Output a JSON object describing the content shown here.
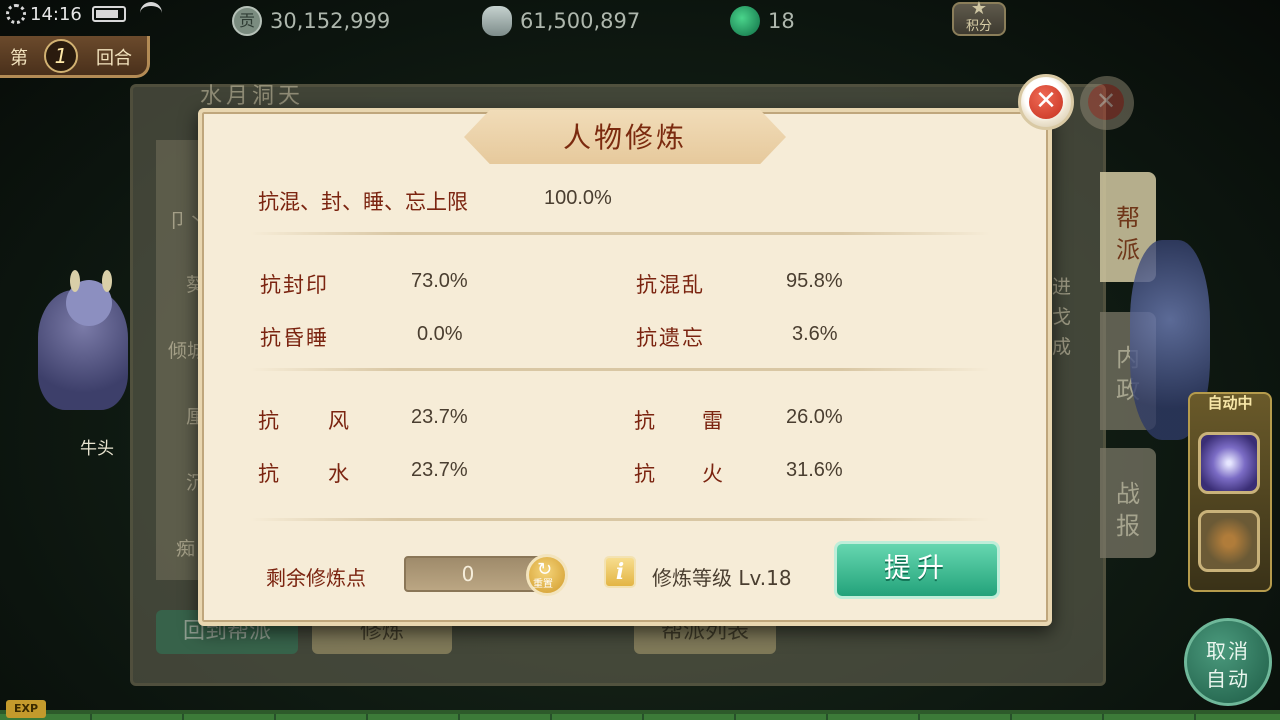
{
  "status_bar": {
    "time": "14:16"
  },
  "resources": {
    "contribution": "30,152,999",
    "silver": "61,500,897",
    "jade": "18",
    "score_label": "积分"
  },
  "round": {
    "prefix": "第",
    "number": "1",
    "suffix": "回合"
  },
  "background": {
    "panel_title": "水月洞天",
    "row_labels": [
      "卩丶",
      "葵",
      "倾城",
      "厘",
      "沉",
      "痴"
    ],
    "buttons": [
      "回到帮派",
      "修炼",
      "帮派列表"
    ],
    "side_tabs": [
      "帮派",
      "内政",
      "战报"
    ],
    "side_text": [
      "进",
      "戈",
      "成"
    ]
  },
  "npc": {
    "name": "牛头"
  },
  "auto_panel": {
    "label": "自动中"
  },
  "cancel_auto": {
    "line1": "取消",
    "line2": "自动"
  },
  "exp_badge": "EXP",
  "modal": {
    "title": "人物修炼",
    "upper_limit": {
      "label": "抗混、封、睡、忘上限",
      "value": "100.0%"
    },
    "stats_group1": [
      {
        "label": "抗封印",
        "value": "73.0%"
      },
      {
        "label": "抗混乱",
        "value": "95.8%"
      },
      {
        "label": "抗昏睡",
        "value": "0.0%"
      },
      {
        "label": "抗遗忘",
        "value": "3.6%"
      }
    ],
    "stats_group2": [
      {
        "label_a": "抗",
        "label_b": "风",
        "value": "23.7%"
      },
      {
        "label_a": "抗",
        "label_b": "雷",
        "value": "26.0%"
      },
      {
        "label_a": "抗",
        "label_b": "水",
        "value": "23.7%"
      },
      {
        "label_a": "抗",
        "label_b": "火",
        "value": "31.6%"
      }
    ],
    "remaining_points_label": "剩余修炼点",
    "remaining_points": "0",
    "reset_label": "重置",
    "level_text": "修炼等级 Lv.18",
    "upgrade_button": "提升",
    "close_symbol": "✕"
  },
  "colors": {
    "title_red": "#7b2a0f",
    "upgrade_green": "#2fb285",
    "panel_bg": "#f6ecd7"
  }
}
